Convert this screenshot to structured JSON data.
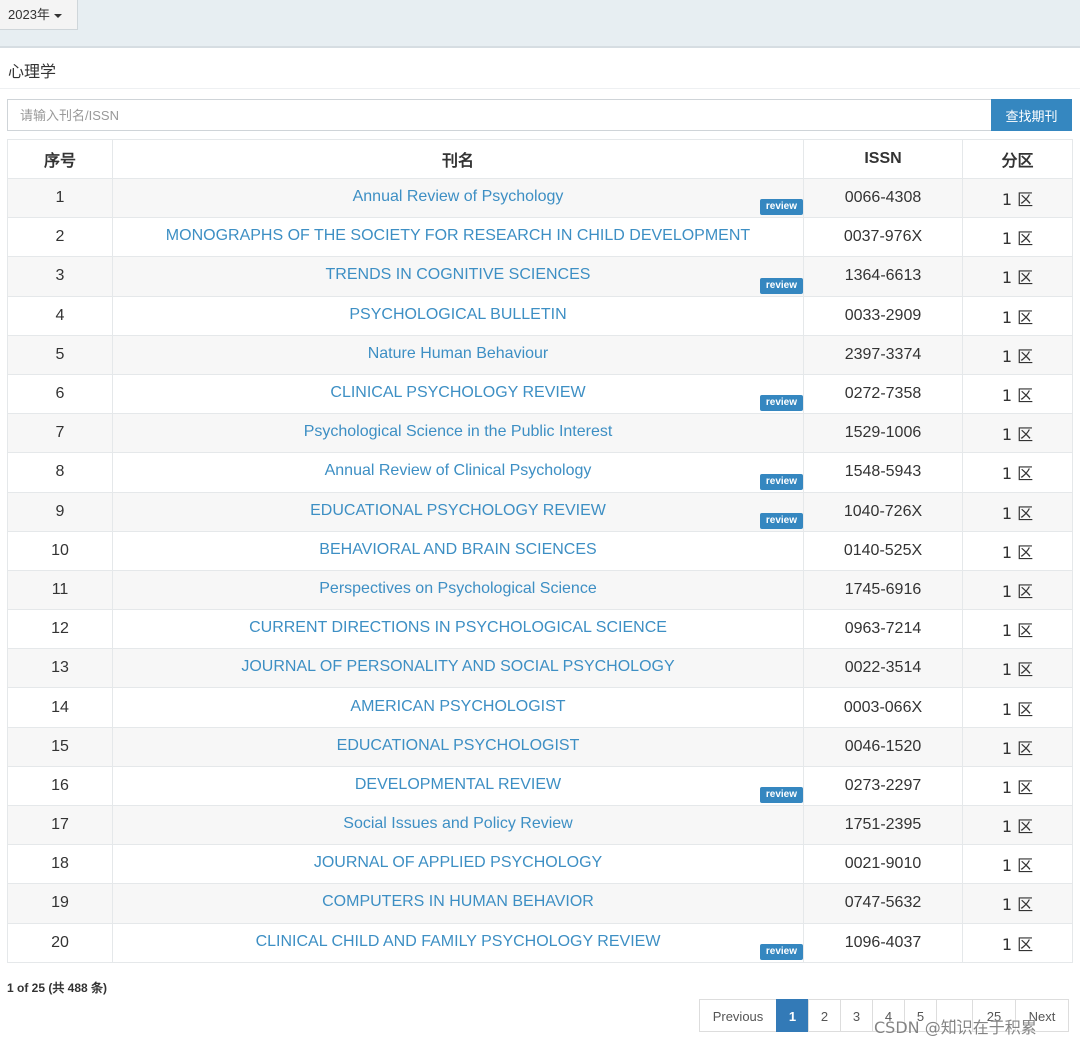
{
  "year_selector": {
    "label": "2023年"
  },
  "category_title": "心理学",
  "search": {
    "placeholder": "请输入刊名/ISSN",
    "value": "",
    "button_label": "查找期刊"
  },
  "table": {
    "headers": [
      "序号",
      "刊名",
      "ISSN",
      "分区"
    ],
    "rows": [
      {
        "no": "1",
        "name": "Annual Review of Psychology",
        "issn": "0066-4308",
        "zone": "1 区",
        "review": "review"
      },
      {
        "no": "2",
        "name": "MONOGRAPHS OF THE SOCIETY FOR RESEARCH IN CHILD DEVELOPMENT",
        "issn": "0037-976X",
        "zone": "1 区",
        "review": ""
      },
      {
        "no": "3",
        "name": "TRENDS IN COGNITIVE SCIENCES",
        "issn": "1364-6613",
        "zone": "1 区",
        "review": "review"
      },
      {
        "no": "4",
        "name": "PSYCHOLOGICAL BULLETIN",
        "issn": "0033-2909",
        "zone": "1 区",
        "review": ""
      },
      {
        "no": "5",
        "name": "Nature Human Behaviour",
        "issn": "2397-3374",
        "zone": "1 区",
        "review": ""
      },
      {
        "no": "6",
        "name": "CLINICAL PSYCHOLOGY REVIEW",
        "issn": "0272-7358",
        "zone": "1 区",
        "review": "review"
      },
      {
        "no": "7",
        "name": "Psychological Science in the Public Interest",
        "issn": "1529-1006",
        "zone": "1 区",
        "review": ""
      },
      {
        "no": "8",
        "name": "Annual Review of Clinical Psychology",
        "issn": "1548-5943",
        "zone": "1 区",
        "review": "review"
      },
      {
        "no": "9",
        "name": "EDUCATIONAL PSYCHOLOGY REVIEW",
        "issn": "1040-726X",
        "zone": "1 区",
        "review": "review"
      },
      {
        "no": "10",
        "name": "BEHAVIORAL AND BRAIN SCIENCES",
        "issn": "0140-525X",
        "zone": "1 区",
        "review": ""
      },
      {
        "no": "11",
        "name": "Perspectives on Psychological Science",
        "issn": "1745-6916",
        "zone": "1 区",
        "review": ""
      },
      {
        "no": "12",
        "name": "CURRENT DIRECTIONS IN PSYCHOLOGICAL SCIENCE",
        "issn": "0963-7214",
        "zone": "1 区",
        "review": ""
      },
      {
        "no": "13",
        "name": "JOURNAL OF PERSONALITY AND SOCIAL PSYCHOLOGY",
        "issn": "0022-3514",
        "zone": "1 区",
        "review": ""
      },
      {
        "no": "14",
        "name": "AMERICAN PSYCHOLOGIST",
        "issn": "0003-066X",
        "zone": "1 区",
        "review": ""
      },
      {
        "no": "15",
        "name": "EDUCATIONAL PSYCHOLOGIST",
        "issn": "0046-1520",
        "zone": "1 区",
        "review": ""
      },
      {
        "no": "16",
        "name": "DEVELOPMENTAL REVIEW",
        "issn": "0273-2297",
        "zone": "1 区",
        "review": "review"
      },
      {
        "no": "17",
        "name": "Social Issues and Policy Review",
        "issn": "1751-2395",
        "zone": "1 区",
        "review": ""
      },
      {
        "no": "18",
        "name": "JOURNAL OF APPLIED PSYCHOLOGY",
        "issn": "0021-9010",
        "zone": "1 区",
        "review": ""
      },
      {
        "no": "19",
        "name": "COMPUTERS IN HUMAN BEHAVIOR",
        "issn": "0747-5632",
        "zone": "1 区",
        "review": ""
      },
      {
        "no": "20",
        "name": "CLINICAL CHILD AND FAMILY PSYCHOLOGY REVIEW",
        "issn": "1096-4037",
        "zone": "1 区",
        "review": "review"
      }
    ]
  },
  "footer": {
    "summary": "1 of 25 (共 488 条)"
  },
  "pagination": {
    "items": [
      {
        "label": "Previous",
        "active": false
      },
      {
        "label": "1",
        "active": true
      },
      {
        "label": "2",
        "active": false
      },
      {
        "label": "3",
        "active": false
      },
      {
        "label": "4",
        "active": false
      },
      {
        "label": "5",
        "active": false
      },
      {
        "label": "...",
        "active": false
      },
      {
        "label": "25",
        "active": false
      },
      {
        "label": "Next",
        "active": false
      }
    ]
  },
  "watermark": "CSDN @知识在于积累",
  "colors": {
    "accent": "#3587c0",
    "link": "#3d8fc4",
    "topbar": "#e7eef2"
  }
}
